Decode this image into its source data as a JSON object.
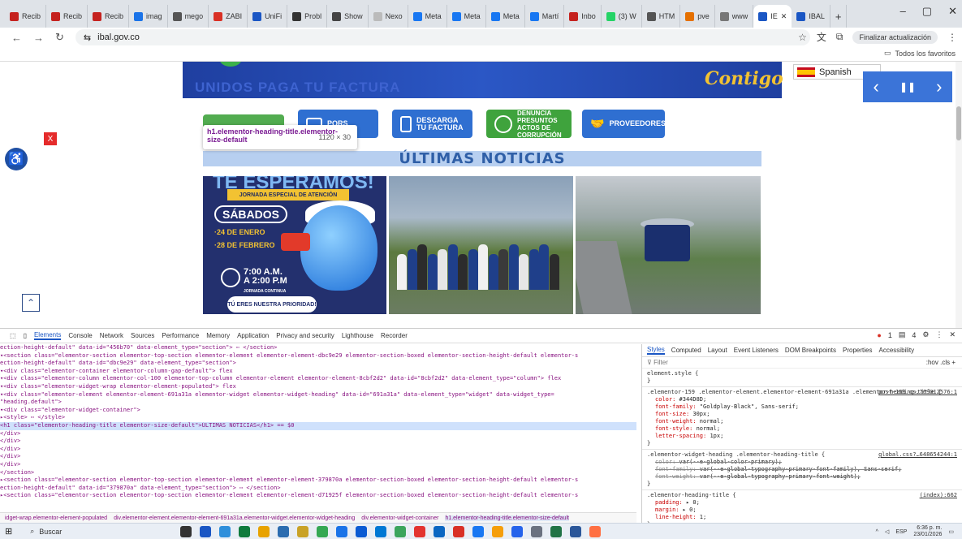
{
  "browser": {
    "tabs": [
      {
        "label": "Recib",
        "color": "#c5221f"
      },
      {
        "label": "Recib",
        "color": "#c5221f"
      },
      {
        "label": "Recib",
        "color": "#c5221f"
      },
      {
        "label": "imag",
        "color": "#1a73e8"
      },
      {
        "label": "mego",
        "color": "#555555"
      },
      {
        "label": "ZABI",
        "color": "#d93025"
      },
      {
        "label": "UniFi",
        "color": "#1a56c4"
      },
      {
        "label": "Probl",
        "color": "#333333"
      },
      {
        "label": "Show",
        "color": "#444444"
      },
      {
        "label": "Nexo",
        "color": "#bbbbbb"
      },
      {
        "label": "Meta",
        "color": "#1877f2"
      },
      {
        "label": "Meta",
        "color": "#1877f2"
      },
      {
        "label": "Meta",
        "color": "#1877f2"
      },
      {
        "label": "Martí",
        "color": "#1877f2"
      },
      {
        "label": "Inbo",
        "color": "#c5221f"
      },
      {
        "label": "(3) W",
        "color": "#25d366"
      },
      {
        "label": "HTM",
        "color": "#555555"
      },
      {
        "label": "pve",
        "color": "#e57000"
      },
      {
        "label": "www",
        "color": "#777777"
      },
      {
        "label": "IE",
        "color": "#1a56c4",
        "active": true
      },
      {
        "label": "IBAL",
        "color": "#1a56c4"
      }
    ],
    "url": "ibal.gov.co",
    "update_label": "Finalizar actualización",
    "favorites_label": "Todos los favoritos"
  },
  "site": {
    "language": "Spanish",
    "contigo": "Contigo",
    "banner_ghost": "UNIDOS PAGA TU FACTURA",
    "buttons": [
      {
        "label": "PQRS"
      },
      {
        "label": "DESCARGA TU FACTURA"
      },
      {
        "label": "DENUNCIA PRESUNTOS ACTOS DE CORRUPCIÓN"
      },
      {
        "label": "PROVEEDORES"
      }
    ],
    "tooltip_selector": "h1.elementor-heading-title.elementor-size-default",
    "tooltip_size": "1120 × 30",
    "close_x": "X",
    "heading": "ÚLTIMAS NOTICIAS",
    "poster": {
      "title": "TE ESPERAMOS!",
      "bar": "JORNADA ESPECIAL DE ATENCIÓN",
      "day": "SÁBADOS",
      "date1": "·24 DE ENERO",
      "date2": "·28 DE FEBRERO",
      "time1": "7:00 A.M.",
      "time2": "A 2:00 P.M",
      "time_note": "JORNADA CONTINUA",
      "footer": "TÚ ERES NUESTRA PRIORIDAD!"
    }
  },
  "devtools": {
    "tabs": [
      "Elements",
      "Console",
      "Network",
      "Sources",
      "Performance",
      "Memory",
      "Application",
      "Privacy and security",
      "Lighthouse",
      "Recorder"
    ],
    "errors": "1",
    "warnings": "4",
    "dom_lines": [
      "ection-height-default\" data-id=\"456b70\" data-element_type=\"section\"> ⋯ </section>",
      "▾<section class=\"elementor-section elementor-top-section elementor-element elementor-element-dbc9e29 elementor-section-boxed elementor-section-height-default elementor-s",
      "ection-height-default\" data-id=\"dbc9e29\" data-element_type=\"section\">",
      "  ▾<div class=\"elementor-container elementor-column-gap-default\"> flex",
      "    ▾<div class=\"elementor-column elementor-col-100 elementor-top-column elementor-element elementor-element-8cbf2d2\" data-id=\"8cbf2d2\" data-element_type=\"column\"> flex",
      "      ▾<div class=\"elementor-widget-wrap elementor-element-populated\"> flex",
      "        ▾<div class=\"elementor-element elementor-element-691a31a elementor-widget elementor-widget-heading\" data-id=\"691a31a\" data-element_type=\"widget\" data-widget_type=",
      "         \"heading.default\">",
      "          ▾<div class=\"elementor-widget-container\">",
      "            ▸<style> ⋯ </style>",
      "              <h1 class=\"elementor-heading-title elementor-size-default\">ÚLTIMAS NOTICIAS</h1> == $0",
      "            </div>",
      "          </div>",
      "        </div>",
      "      </div>",
      "    </div>",
      "  </section>",
      "▸<section class=\"elementor-section elementor-top-section elementor-element elementor-element-379870a elementor-section-boxed elementor-section-height-default elementor-s",
      "ection-height-default\" data-id=\"379870a\" data-element_type=\"section\"> ⋯ </section>",
      "▸<section class=\"elementor-section elementor-top-section elementor-element elementor-element-d71925f elementor-section-boxed elementor-section-height-default elementor-s"
    ],
    "highlight_line": 10,
    "breadcrumbs": [
      "idget-wrap.elementor-element-populated",
      "div.elementor-element.elementor-element-691a31a.elementor-widget.elementor-widget-heading",
      "div.elementor-widget-container",
      "h1.elementor-heading-title.elementor-size-default"
    ],
    "style_tabs": [
      "Styles",
      "Computed",
      "Layout",
      "Event Listeners",
      "DOM Breakpoints",
      "Properties",
      "Accessibility"
    ],
    "filter_placeholder": "Filter",
    "filter_right": ":hov .cls +",
    "rules": [
      {
        "selector": "element.style {",
        "source": "",
        "props": []
      },
      {
        "selector": ".elementor-159 .elementor-element.elementor-element-691a31a .elementor-heading-title {",
        "source": "post-159.cs…769012576:1",
        "props": [
          {
            "name": "color",
            "value": "#344D8D;",
            "strike": false
          },
          {
            "name": "font-family",
            "value": "\"Goldplay-Black\", Sans-serif;",
            "strike": false
          },
          {
            "name": "font-size",
            "value": "30px;",
            "strike": false
          },
          {
            "name": "font-weight",
            "value": "normal;",
            "strike": false
          },
          {
            "name": "font-style",
            "value": "normal;",
            "strike": false
          },
          {
            "name": "letter-spacing",
            "value": "1px;",
            "strike": false
          }
        ]
      },
      {
        "selector": ".elementor-widget-heading .elementor-heading-title {",
        "source": "global.css?…648654244:1",
        "props": [
          {
            "name": "color",
            "value": "var(--e-global-color-primary);",
            "strike": true
          },
          {
            "name": "font-family",
            "value": "var(--e-global-typography-primary-font-family), Sans-serif;",
            "strike": true
          },
          {
            "name": "font-weight",
            "value": "var(--e-global-typography-primary-font-weight);",
            "strike": true
          }
        ]
      },
      {
        "selector": ".elementor-heading-title {",
        "source": "(index):662",
        "props": [
          {
            "name": "padding",
            "value": "▸ 0;",
            "strike": false
          },
          {
            "name": "margin",
            "value": "▸ 0;",
            "strike": false
          },
          {
            "name": "line-height",
            "value": "1;",
            "strike": false
          }
        ]
      }
    ]
  },
  "taskbar": {
    "search_label": "Buscar",
    "lang": "ESP",
    "time": "6:36 p. m.",
    "date": "23/01/2026",
    "icon_colors": [
      "#333333",
      "#1a56c4",
      "#2f8fdb",
      "#0f7b3d",
      "#e8a200",
      "#2b6cb0",
      "#c9a227",
      "#34a853",
      "#1a73e8",
      "#0b5bd3",
      "#0078d4",
      "#3ba55c",
      "#e3342f",
      "#0a66c2",
      "#d93025",
      "#1877f2",
      "#f59e0b",
      "#2563eb",
      "#6b7280",
      "#217346",
      "#2b579a",
      "#ff7043"
    ]
  }
}
